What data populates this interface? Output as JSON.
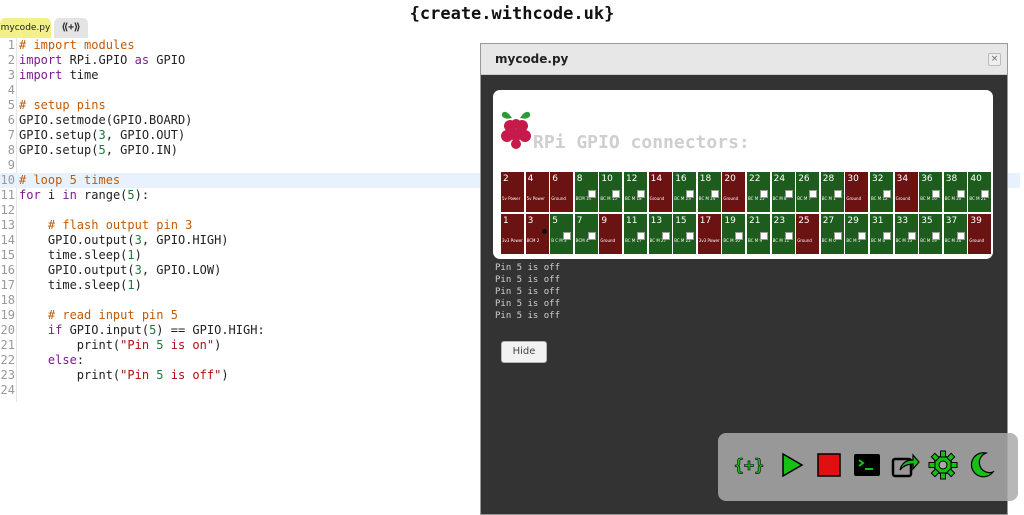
{
  "brand": "{create.withcode.uk}",
  "tabs": [
    {
      "label": "mycode.py"
    },
    {
      "label": "⟪+⟫"
    }
  ],
  "code_lines": [
    {
      "n": "1",
      "text": "# import modules"
    },
    {
      "n": "2",
      "text": "import RPi.GPIO as GPIO"
    },
    {
      "n": "3",
      "text": "import time"
    },
    {
      "n": "4",
      "text": ""
    },
    {
      "n": "5",
      "text": "# setup pins"
    },
    {
      "n": "6",
      "text": "GPIO.setmode(GPIO.BOARD)"
    },
    {
      "n": "7",
      "text": "GPIO.setup(3, GPIO.OUT)"
    },
    {
      "n": "8",
      "text": "GPIO.setup(5, GPIO.IN)"
    },
    {
      "n": "9",
      "text": ""
    },
    {
      "n": "10",
      "text": "# loop 5 times"
    },
    {
      "n": "11",
      "text": "for i in range(5):"
    },
    {
      "n": "12",
      "text": ""
    },
    {
      "n": "13",
      "text": "    # flash output pin 3"
    },
    {
      "n": "14",
      "text": "    GPIO.output(3, GPIO.HIGH)"
    },
    {
      "n": "15",
      "text": "    time.sleep(1)"
    },
    {
      "n": "16",
      "text": "    GPIO.output(3, GPIO.LOW)"
    },
    {
      "n": "17",
      "text": "    time.sleep(1)"
    },
    {
      "n": "18",
      "text": ""
    },
    {
      "n": "19",
      "text": "    # read input pin 5"
    },
    {
      "n": "20",
      "text": "    if GPIO.input(5) == GPIO.HIGH:"
    },
    {
      "n": "21",
      "text": "        print(\"Pin 5 is on\")"
    },
    {
      "n": "22",
      "text": "    else:"
    },
    {
      "n": "23",
      "text": "        print(\"Pin 5 is off\")"
    },
    {
      "n": "24",
      "text": ""
    }
  ],
  "highlighted_line": "10",
  "panel": {
    "title": "mycode.py",
    "close": "×",
    "gpio_title": "RPi GPIO connectors:",
    "hide_label": "Hide"
  },
  "pins_top": [
    {
      "num": "2",
      "label": "5v Power",
      "color": "red",
      "chk": false
    },
    {
      "num": "4",
      "label": "5v Power",
      "color": "red",
      "chk": false
    },
    {
      "num": "6",
      "label": "Ground",
      "color": "red",
      "chk": false
    },
    {
      "num": "8",
      "label": "BCM 14",
      "color": "green",
      "chk": true
    },
    {
      "num": "10",
      "label": "BC M 15",
      "color": "green",
      "chk": true
    },
    {
      "num": "12",
      "label": "BC M 18",
      "color": "green",
      "chk": true
    },
    {
      "num": "14",
      "label": "Ground",
      "color": "red",
      "chk": false
    },
    {
      "num": "16",
      "label": "BC M 23",
      "color": "green",
      "chk": true
    },
    {
      "num": "18",
      "label": "BC M 24",
      "color": "green",
      "chk": true
    },
    {
      "num": "20",
      "label": "Ground",
      "color": "red",
      "chk": false
    },
    {
      "num": "22",
      "label": "BC M 25",
      "color": "green",
      "chk": true
    },
    {
      "num": "24",
      "label": "BC M 8",
      "color": "green",
      "chk": true
    },
    {
      "num": "26",
      "label": "BC M 7",
      "color": "green",
      "chk": true
    },
    {
      "num": "28",
      "label": "BC M 1",
      "color": "green",
      "chk": true
    },
    {
      "num": "30",
      "label": "Ground",
      "color": "red",
      "chk": false
    },
    {
      "num": "32",
      "label": "BC M 12",
      "color": "green",
      "chk": true
    },
    {
      "num": "34",
      "label": "Ground",
      "color": "red",
      "chk": false
    },
    {
      "num": "36",
      "label": "BC M 16",
      "color": "green",
      "chk": true
    },
    {
      "num": "38",
      "label": "BC M 20",
      "color": "green",
      "chk": true
    },
    {
      "num": "40",
      "label": "BC M 21",
      "color": "green",
      "chk": true
    }
  ],
  "pins_bottom": [
    {
      "num": "1",
      "label": "3v3 Power",
      "color": "red",
      "chk": false
    },
    {
      "num": "3",
      "label": "BCM 2",
      "color": "red",
      "chk": false,
      "led": true
    },
    {
      "num": "5",
      "label": "B C M 3",
      "color": "green",
      "chk": true
    },
    {
      "num": "7",
      "label": "BCM 4",
      "color": "green",
      "chk": true
    },
    {
      "num": "9",
      "label": "Ground",
      "color": "red",
      "chk": false
    },
    {
      "num": "11",
      "label": "BC M 17",
      "color": "green",
      "chk": true
    },
    {
      "num": "13",
      "label": "BC M 27",
      "color": "green",
      "chk": true
    },
    {
      "num": "15",
      "label": "BC M 22",
      "color": "green",
      "chk": true
    },
    {
      "num": "17",
      "label": "3v3 Power",
      "color": "red",
      "chk": false
    },
    {
      "num": "19",
      "label": "BC M 10",
      "color": "green",
      "chk": true
    },
    {
      "num": "21",
      "label": "BC M 9",
      "color": "green",
      "chk": true
    },
    {
      "num": "23",
      "label": "BC M 11",
      "color": "green",
      "chk": true
    },
    {
      "num": "25",
      "label": "Ground",
      "color": "red",
      "chk": false
    },
    {
      "num": "27",
      "label": "BC M 0",
      "color": "green",
      "chk": true
    },
    {
      "num": "29",
      "label": "BC M 5",
      "color": "green",
      "chk": true
    },
    {
      "num": "31",
      "label": "BC M 6",
      "color": "green",
      "chk": true
    },
    {
      "num": "33",
      "label": "BC M 13",
      "color": "green",
      "chk": true
    },
    {
      "num": "35",
      "label": "BC M 19",
      "color": "green",
      "chk": true
    },
    {
      "num": "37",
      "label": "BC M 26",
      "color": "green",
      "chk": true
    },
    {
      "num": "39",
      "label": "Ground",
      "color": "red",
      "chk": false
    }
  ],
  "console_lines": [
    "Pin 5 is off",
    "Pin 5 is off",
    "Pin 5 is off",
    "Pin 5 is off",
    "Pin 5 is off"
  ],
  "toolbar": [
    {
      "icon": "add-file-icon"
    },
    {
      "icon": "run-icon"
    },
    {
      "icon": "stop-icon"
    },
    {
      "icon": "terminal-icon"
    },
    {
      "icon": "share-icon"
    },
    {
      "icon": "settings-icon"
    },
    {
      "icon": "theme-icon"
    }
  ],
  "colors": {
    "pin_green": "#1d5c1d",
    "pin_red": "#6b1212",
    "accent_green": "#16c016",
    "stop_red": "#e01010",
    "tab_active": "#f3f08a"
  }
}
